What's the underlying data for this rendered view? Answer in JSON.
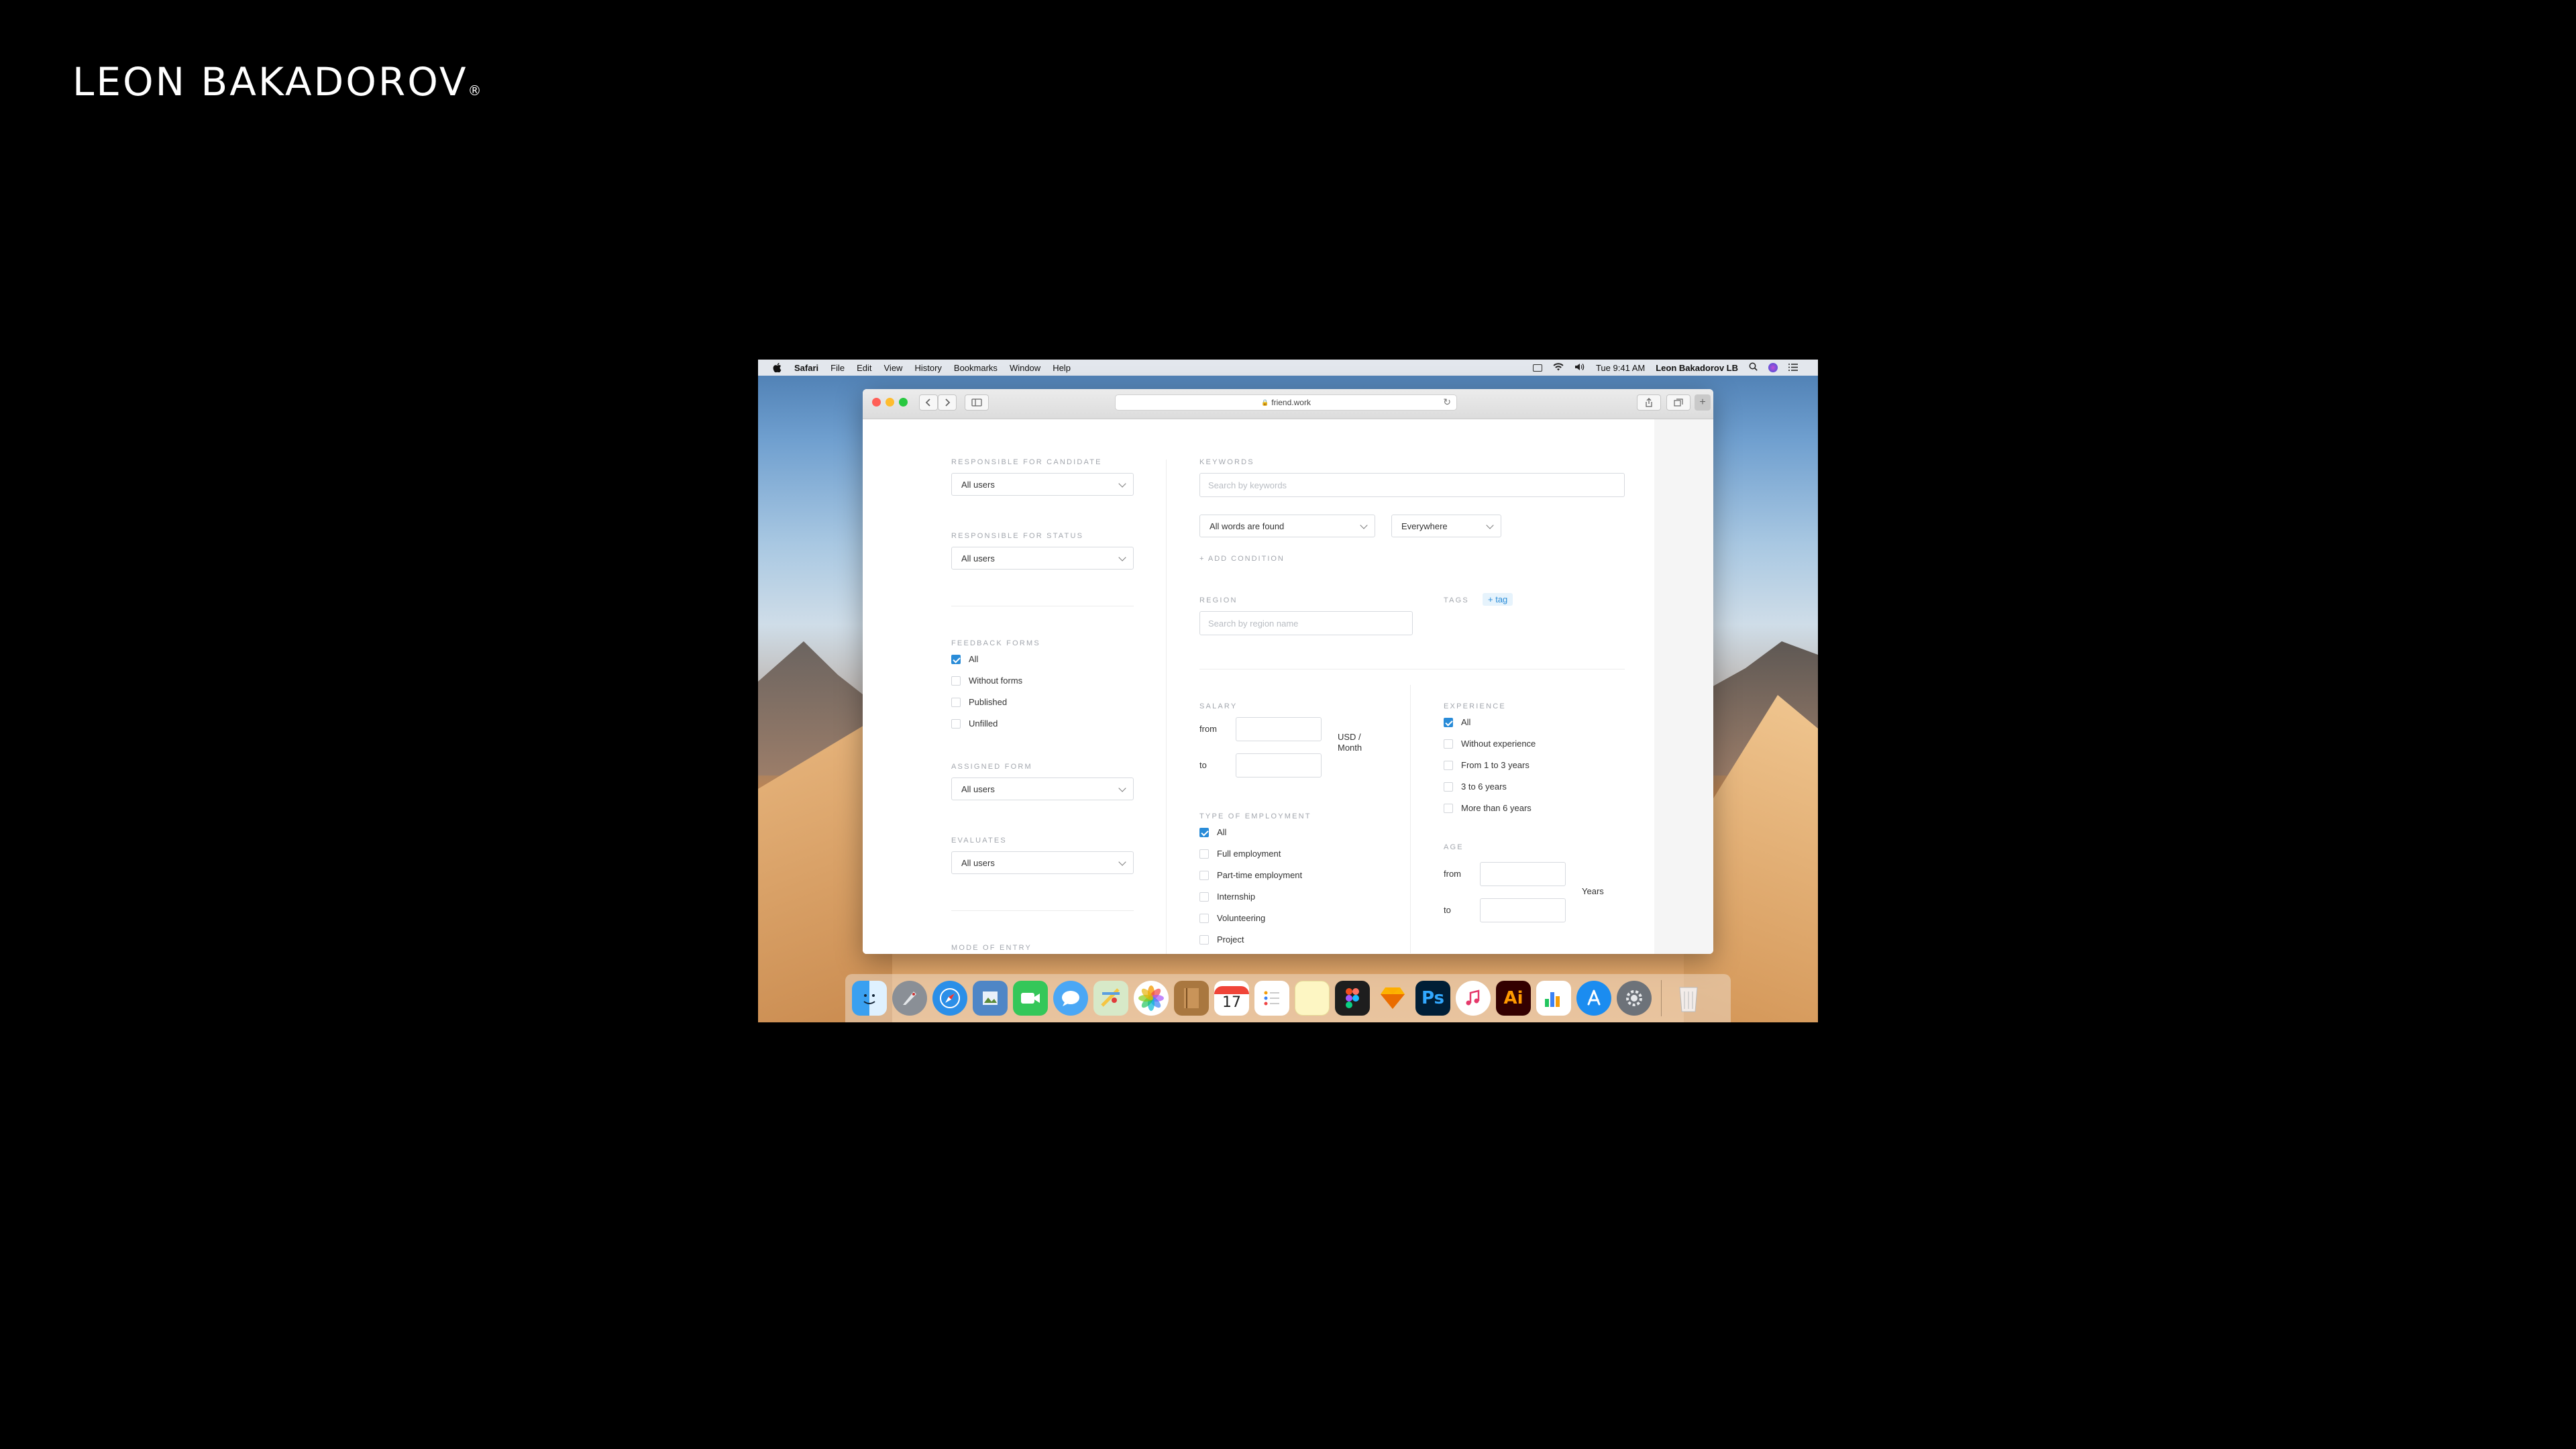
{
  "brand": {
    "name": "LEON BAKADOROV",
    "reg": "®"
  },
  "menubar": {
    "items": [
      "Safari",
      "File",
      "Edit",
      "View",
      "History",
      "Bookmarks",
      "Window",
      "Help"
    ],
    "clock": "Tue 9:41 AM",
    "user": "Leon Bakadorov LB"
  },
  "browser": {
    "url": "friend.work",
    "lock": "🔒"
  },
  "form": {
    "left": {
      "responsible_candidate": {
        "label": "RESPONSIBLE FOR CANDIDATE",
        "value": "All users"
      },
      "responsible_status": {
        "label": "RESPONSIBLE FOR STATUS",
        "value": "All users"
      },
      "feedback_forms": {
        "label": "FEEDBACK FORMS",
        "options": [
          {
            "label": "All",
            "checked": true
          },
          {
            "label": "Without forms",
            "checked": false
          },
          {
            "label": "Published",
            "checked": false
          },
          {
            "label": "Unfilled",
            "checked": false
          }
        ]
      },
      "assigned_form": {
        "label": "ASSIGNED FORM",
        "value": "All users"
      },
      "evaluates": {
        "label": "EVALUATES",
        "value": "All users"
      },
      "mode_of_entry": {
        "label": "MODE OF ENTRY"
      }
    },
    "keywords": {
      "label": "KEYWORDS",
      "placeholder": "Search by keywords",
      "match": "All words are found",
      "scope": "Everywhere",
      "add_condition": "+ ADD CONDITION"
    },
    "region": {
      "label": "REGION",
      "placeholder": "Search by region name"
    },
    "tags": {
      "label": "TAGS",
      "add": "+ tag"
    },
    "salary": {
      "label": "SALARY",
      "from": "from",
      "to": "to",
      "unit": "USD / Month"
    },
    "employment": {
      "label": "TYPE OF EMPLOYMENT",
      "options": [
        {
          "label": "All",
          "checked": true
        },
        {
          "label": "Full employment",
          "checked": false
        },
        {
          "label": "Part-time employment",
          "checked": false
        },
        {
          "label": "Internship",
          "checked": false
        },
        {
          "label": "Volunteering",
          "checked": false
        },
        {
          "label": "Project",
          "checked": false
        }
      ]
    },
    "experience": {
      "label": "EXPERIENCE",
      "options": [
        {
          "label": "All",
          "checked": true
        },
        {
          "label": "Without experience",
          "checked": false
        },
        {
          "label": "From 1 to 3 years",
          "checked": false
        },
        {
          "label": "3 to 6 years",
          "checked": false
        },
        {
          "label": "More than 6 years",
          "checked": false
        }
      ]
    },
    "age": {
      "label": "AGE",
      "from": "from",
      "to": "to",
      "unit": "Years"
    }
  },
  "dock": {
    "apps": [
      "finder-icon",
      "launchpad-icon",
      "safari-icon",
      "preview-icon",
      "facetime-icon",
      "messages-icon",
      "maps-icon",
      "photos-icon",
      "notes-book-icon",
      "calendar-icon",
      "reminders-icon",
      "stickies-icon",
      "figma-icon",
      "sketch-icon",
      "photoshop-icon",
      "itunes-icon",
      "illustrator-icon",
      "numbers-icon",
      "app-store-icon",
      "system-preferences-icon",
      "trash-icon"
    ],
    "calendar_day": "17",
    "photoshop_label": "Ps",
    "illustrator_label": "Ai"
  }
}
